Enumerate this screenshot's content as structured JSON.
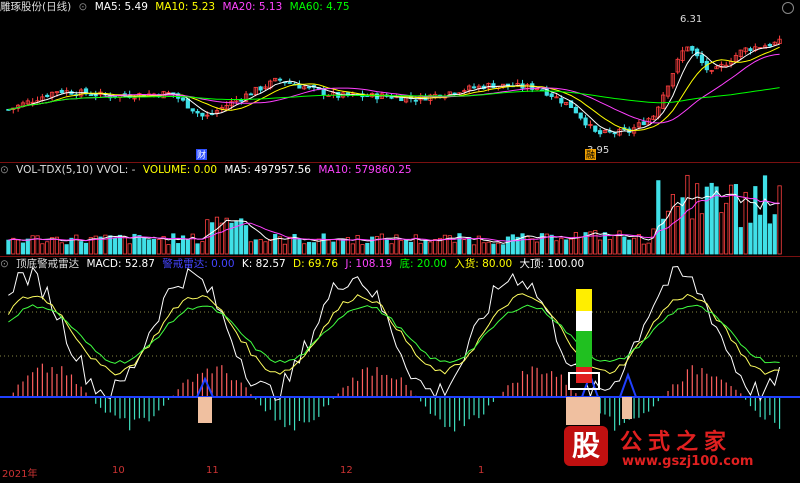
{
  "header": {
    "main": {
      "title": "雕琢股份(日线)",
      "ma5": "MA5: 5.49",
      "ma10": "MA10: 5.23",
      "ma20": "MA20: 5.13",
      "ma60": "MA60: 4.75"
    },
    "vol": {
      "title": "VOL-TDX(5,10)  VVOL: -",
      "volume": "VOLUME: 0.00",
      "ma5": "MA5: 497957.56",
      "ma10": "MA10: 579860.25"
    },
    "ind": {
      "title": "顶底警戒雷达",
      "macd": "MACD: 52.87",
      "radar": "警戒雷达: 0.00",
      "k": "K: 82.57",
      "d": "D: 69.76",
      "j": "J: 108.19",
      "bottom": "底: 20.00",
      "buy": "入货: 80.00",
      "top": "大顶: 100.00"
    }
  },
  "colors": {
    "up": "#ff4040",
    "down": "#40e0e8",
    "ma5": "#ffffff",
    "ma10": "#ffff00",
    "ma20": "#ff40ff",
    "ma60": "#00ff00",
    "radar": "#2040ff",
    "kline": "#ffffff",
    "dline": "#ffff60",
    "jline": "#40ff40"
  },
  "chart_data": [
    {
      "type": "candlestick",
      "annotations": [
        {
          "text": "6.31",
          "label": "high"
        },
        {
          "text": "3.95",
          "label": "low"
        },
        {
          "text": "财",
          "label": "marker"
        },
        {
          "text": "融",
          "label": "marker"
        }
      ],
      "high": 6.31,
      "low": 3.95
    },
    {
      "type": "bar",
      "title": "VOL-TDX(5,10)"
    },
    {
      "type": "line",
      "title": "顶底警戒雷达",
      "levels": [
        {
          "name": "底",
          "value": 20
        },
        {
          "name": "入货",
          "value": 80
        },
        {
          "name": "大顶",
          "value": 100
        }
      ]
    }
  ],
  "xaxis": {
    "labels": [
      "2021年",
      "10",
      "11",
      "12",
      "1"
    ]
  },
  "logo": {
    "glyph": "股",
    "name": "公式之家",
    "url": "www.gszj100.com"
  }
}
